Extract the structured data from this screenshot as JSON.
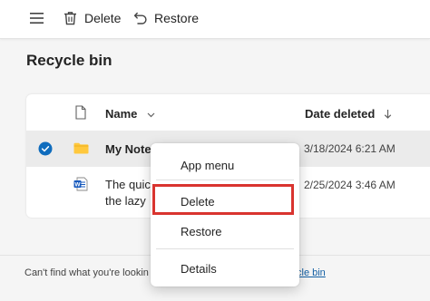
{
  "toolbar": {
    "menu_icon": "hamburger-icon",
    "delete_icon": "trash-icon",
    "delete_label": "Delete",
    "restore_icon": "restore-arrow-icon",
    "restore_label": "Restore"
  },
  "page": {
    "title": "Recycle bin"
  },
  "list": {
    "columns": {
      "type_icon": "file-icon",
      "name": "Name",
      "date_deleted": "Date deleted"
    },
    "rows": [
      {
        "selected": true,
        "type_icon": "folder-icon",
        "name": "My Note",
        "date_deleted": "3/18/2024 6:21 AM"
      },
      {
        "selected": false,
        "type_icon": "word-document-icon",
        "name_line1": "The quic",
        "name_line2": "the lazy",
        "date_deleted": "2/25/2024 3:46 AM"
      }
    ]
  },
  "context_menu": {
    "items": [
      "App menu",
      "Delete",
      "Restore",
      "Details"
    ],
    "highlighted": "Delete"
  },
  "footer": {
    "text": "Can't find what you're lookin",
    "link": "cle bin"
  },
  "colors": {
    "accent_blue": "#0f6cbd",
    "folder_yellow": "#ffc83d",
    "highlight_red": "#d9342f"
  }
}
